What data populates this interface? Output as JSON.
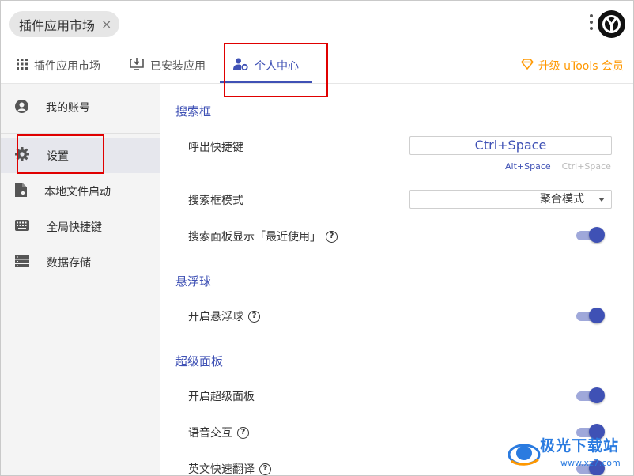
{
  "topbar": {
    "search_pill_text": "插件应用市场",
    "close_glyph": "×"
  },
  "tabs": [
    {
      "label": "插件应用市场",
      "icon": "grid-icon"
    },
    {
      "label": "已安装应用",
      "icon": "download-icon"
    },
    {
      "label": "个人中心",
      "icon": "user-settings-icon",
      "active": true
    }
  ],
  "upgrade": {
    "label": "升级 uTools 会员",
    "icon": "diamond-icon",
    "color": "#ff9800"
  },
  "sidebar": {
    "items": [
      {
        "label": "我的账号",
        "icon": "account-icon"
      },
      {
        "label": "设置",
        "icon": "gear-icon",
        "active": true
      },
      {
        "label": "本地文件启动",
        "icon": "file-icon"
      },
      {
        "label": "全局快捷键",
        "icon": "keyboard-icon"
      },
      {
        "label": "数据存储",
        "icon": "storage-icon"
      }
    ]
  },
  "main": {
    "sections": {
      "search_box": {
        "title": "搜索框",
        "hotkey_label": "呼出快捷键",
        "hotkey_value": "Ctrl+Space",
        "hotkey_options": [
          "Alt+Space",
          "Ctrl+Space"
        ],
        "mode_label": "搜索框模式",
        "mode_value": "聚合模式",
        "recent_label": "搜索面板显示「最近使用」",
        "recent_enabled": true
      },
      "float_ball": {
        "title": "悬浮球",
        "enable_label": "开启悬浮球",
        "enable_enabled": true
      },
      "super_panel": {
        "title": "超级面板",
        "enable_label": "开启超级面板",
        "enable_enabled": true,
        "voice_label": "语音交互",
        "voice_enabled": true,
        "translate_label": "英文快速翻译",
        "translate_enabled": true
      }
    }
  },
  "watermark": {
    "line1": "极光下载站",
    "line2": "www.xz7.com"
  },
  "colors": {
    "accent": "#3f51b5",
    "accent_light": "#9fa8da",
    "highlight_box": "#e00000",
    "upgrade": "#ff9800"
  }
}
